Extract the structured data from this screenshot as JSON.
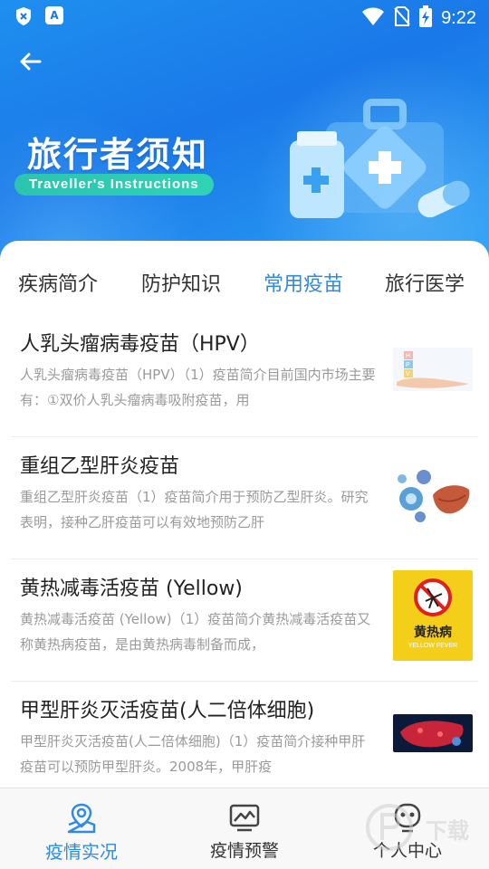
{
  "status_bar": {
    "time": "9:22",
    "left_icons": [
      "shield-x-icon",
      "a-icon"
    ],
    "right_icons": [
      "wifi-icon",
      "no-sim-icon",
      "battery-charging-icon"
    ]
  },
  "header": {
    "back_icon": "arrow-left-icon",
    "title": "旅行者须知",
    "subtitle": "Traveller's Instructions",
    "illustration": "medical-kit-illustration"
  },
  "tabs": [
    {
      "label": "疾病简介",
      "active": false
    },
    {
      "label": "防护知识",
      "active": false
    },
    {
      "label": "常用疫苗",
      "active": true
    },
    {
      "label": "旅行医学",
      "active": false
    }
  ],
  "articles": [
    {
      "title": "人乳头瘤病毒疫苗（HPV）",
      "desc": "人乳头瘤病毒疫苗（HPV）（1）疫苗简介目前国内市场主要有：①双价人乳头瘤病毒吸附疫苗，用",
      "thumb": "hpv-vaccine-thumbnail",
      "thumb_text": "H P V"
    },
    {
      "title": "重组乙型肝炎疫苗",
      "desc": "重组乙型肝炎疫苗（1）疫苗简介用于预防乙型肝炎。研究表明，接种乙肝疫苗可以有效地预防乙肝",
      "thumb": "hepatitis-b-virus-liver-thumbnail"
    },
    {
      "title": "黄热减毒活疫苗 (Yellow)",
      "desc": "黄热减毒活疫苗 (Yellow)（1）疫苗简介黄热减毒活疫苗又称黄热病疫苗，是由黄热病毒制备而成，",
      "thumb": "yellow-fever-thumbnail",
      "thumb_cn": "黄热病",
      "thumb_en": "YELLOW FEVER"
    },
    {
      "title": "甲型肝炎灭活疫苗(人二倍体细胞)",
      "desc": "甲型肝炎灭活疫苗(人二倍体细胞)（1）疫苗简介接种甲肝疫苗可以预防甲型肝炎。2008年，甲肝疫",
      "thumb": "hepatitis-a-liver-thumbnail"
    }
  ],
  "bottom_nav": [
    {
      "label": "疫情实况",
      "icon": "map-location-icon",
      "active": true
    },
    {
      "label": "疫情预警",
      "icon": "monitor-chart-icon",
      "active": false
    },
    {
      "label": "个人中心",
      "icon": "robot-face-icon",
      "active": false
    }
  ],
  "watermark_text": "下载",
  "colors": {
    "primary_blue": "#2f8ae6",
    "hero_blue": "#1a78e8",
    "teal_pill": "#2fd3b5",
    "desc_gray": "#9a9a9a"
  }
}
